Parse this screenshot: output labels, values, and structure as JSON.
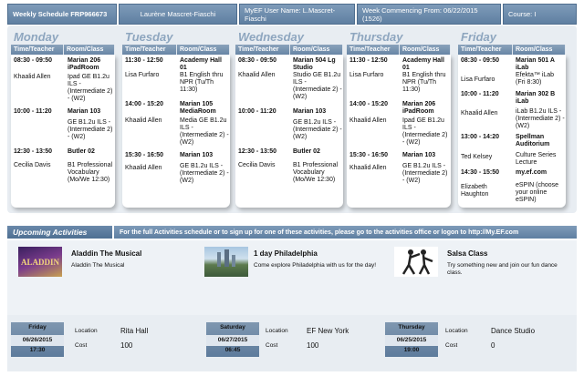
{
  "header": {
    "schedule": "Weekly Schedule FRP966673",
    "name": "Laurène Mascret-Fiaschi",
    "myef_user": "MyEF User Name:  L.Mascret-Fiaschi",
    "week": "Week Commencing From:  06/22/2015 (1526)",
    "course": "Course:  I"
  },
  "columns": {
    "time": "Time/Teacher",
    "room": "Room/Class"
  },
  "days": [
    {
      "name": "Monday",
      "slots": [
        {
          "time": "08:30 - 09:50",
          "teacher": "Khaalid Allen",
          "room": "Marian 206 iPadRoom",
          "cls": "Ipad GE B1.2u ILS - (Intermediate 2) - (W2)"
        },
        {
          "time": "10:00 - 11:20",
          "teacher": "",
          "room": "Marian 103",
          "cls": "GE B1.2u ILS - (Intermediate 2) - (W2)"
        },
        {
          "time": "12:30 - 13:50",
          "teacher": "Cecilia Davis",
          "room": "Butler 02",
          "cls": "B1 Professional Vocabulary (Mo/We 12:30)"
        }
      ]
    },
    {
      "name": "Tuesday",
      "slots": [
        {
          "time": "11:30 - 12:50",
          "teacher": "Lisa Furfaro",
          "room": "Academy Hall 01",
          "cls": "B1 English thru NPR (Tu/Th 11:30)"
        },
        {
          "time": "14:00 - 15:20",
          "teacher": "Khaalid Allen",
          "room": "Marian 105 MediaRoom",
          "cls": "Media GE B1.2u ILS - (Intermediate 2) - (W2)"
        },
        {
          "time": "15:30 - 16:50",
          "teacher": "Khaalid Allen",
          "room": "Marian 103",
          "cls": "GE B1.2u ILS - (Intermediate 2) - (W2)"
        }
      ]
    },
    {
      "name": "Wednesday",
      "slots": [
        {
          "time": "08:30 - 09:50",
          "teacher": "Khaalid Allen",
          "room": "Marian 504 Lg Studio",
          "cls": "Studio GE B1.2u ILS - (Intermediate 2) - (W2)"
        },
        {
          "time": "10:00 - 11:20",
          "teacher": "",
          "room": "Marian 103",
          "cls": "GE B1.2u ILS - (Intermediate 2) - (W2)"
        },
        {
          "time": "12:30 - 13:50",
          "teacher": "Cecilia Davis",
          "room": "Butler 02",
          "cls": "B1 Professional Vocabulary (Mo/We 12:30)"
        }
      ]
    },
    {
      "name": "Thursday",
      "slots": [
        {
          "time": "11:30 - 12:50",
          "teacher": "Lisa Furfaro",
          "room": "Academy Hall 01",
          "cls": "B1 English thru NPR (Tu/Th 11:30)"
        },
        {
          "time": "14:00 - 15:20",
          "teacher": "Khaalid Allen",
          "room": "Marian 206 iPadRoom",
          "cls": "Ipad GE B1.2u ILS - (Intermediate 2) - (W2)"
        },
        {
          "time": "15:30 - 16:50",
          "teacher": "Khaalid Allen",
          "room": "Marian 103",
          "cls": "GE B1.2u ILS - (Intermediate 2) - (W2)"
        }
      ]
    },
    {
      "name": "Friday",
      "slots": [
        {
          "time": "08:30 - 09:50",
          "teacher": "Lisa Furfaro",
          "room": "Marian 501 A iLab",
          "cls": "Efekta™ iLab (Fri 8:30)"
        },
        {
          "time": "10:00 - 11:20",
          "teacher": "Khaalid Allen",
          "room": "Marian 302 B iLab",
          "cls": "iLab B1.2u ILS - (Intermediate 2) - (W2)"
        },
        {
          "time": "13:00 - 14:20",
          "teacher": "Ted Kelsey",
          "room": "Spellman Auditorium",
          "cls": "Culture Series Lecture"
        },
        {
          "time": "14:30 - 15:50",
          "teacher": "Elizabeth Haughton",
          "room": "my.ef.com",
          "cls": "eSPIN (choose your online eSPIN)"
        }
      ]
    }
  ],
  "upcoming": {
    "title": "Upcoming Activities",
    "info": "For the full Activities schedule or to sign up for one of these activities, please go to the activities office or logon to http://My.EF.com",
    "items": [
      {
        "title": "Aladdin The Musical",
        "desc": "Aladdin The Musical",
        "thumb_text": "ALADDIN"
      },
      {
        "title": "1 day Philadelphia",
        "desc": "Come explore Philadelphia with us for the day!"
      },
      {
        "title": "Salsa Class",
        "desc": "Try something new and join our  fun dance class."
      }
    ]
  },
  "events": [
    {
      "day": "Friday",
      "date": "06/26/2015",
      "time": "17:30",
      "location_label": "Location",
      "location": "Rita Hall",
      "cost_label": "Cost",
      "cost": "100"
    },
    {
      "day": "Saturday",
      "date": "06/27/2015",
      "time": "06:45",
      "location_label": "Location",
      "location": "EF New York",
      "cost_label": "Cost",
      "cost": "100"
    },
    {
      "day": "Thursday",
      "date": "06/25/2015",
      "time": "19:00",
      "location_label": "Location",
      "location": "Dance Studio",
      "cost_label": "Cost",
      "cost": "0"
    }
  ]
}
